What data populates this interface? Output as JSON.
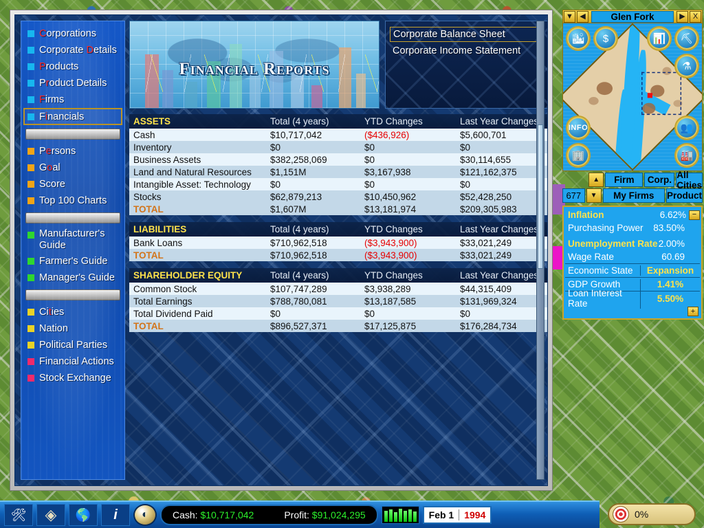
{
  "sidebar": {
    "items": [
      {
        "label": "Corporations",
        "hotkey": "C",
        "color": "#17b6ef",
        "selected": false
      },
      {
        "label": "Corporate Details",
        "hotkey": "D",
        "color": "#17b6ef",
        "selected": false
      },
      {
        "label": "Products",
        "hotkey": "P",
        "color": "#17b6ef",
        "selected": false
      },
      {
        "label": "Product Details",
        "hotkey": "r",
        "color": "#17b6ef",
        "selected": false
      },
      {
        "label": "Firms",
        "hotkey": "F",
        "color": "#17b6ef",
        "selected": false
      },
      {
        "label": "Financials",
        "hotkey": "i",
        "color": "#17b6ef",
        "selected": true
      },
      {
        "separator": true
      },
      {
        "label": "Persons",
        "hotkey": "e",
        "color": "#f0a417",
        "selected": false
      },
      {
        "label": "Goal",
        "hotkey": "o",
        "color": "#f0a417",
        "selected": false
      },
      {
        "label": "Score",
        "hotkey": "",
        "color": "#f0a417",
        "selected": false
      },
      {
        "label": "Top 100 Charts",
        "hotkey": "",
        "color": "#f0a417",
        "selected": false
      },
      {
        "separator": true
      },
      {
        "label": "Manufacturer's Guide",
        "hotkey": "",
        "color": "#2fd62f",
        "selected": false,
        "two_line": true
      },
      {
        "label": "Farmer's Guide",
        "hotkey": "",
        "color": "#2fd62f",
        "selected": false
      },
      {
        "label": "Manager's Guide",
        "hotkey": "",
        "color": "#2fd62f",
        "selected": false
      },
      {
        "separator": true
      },
      {
        "label": "Cities",
        "hotkey": "t",
        "color": "#e8d227",
        "selected": false
      },
      {
        "label": "Nation",
        "hotkey": "",
        "color": "#e8d227",
        "selected": false
      },
      {
        "label": "Political Parties",
        "hotkey": "",
        "color": "#e8d227",
        "selected": false
      },
      {
        "label": "Financial Actions",
        "hotkey": "",
        "color": "#ef2a6b",
        "selected": false
      },
      {
        "label": "Stock Exchange",
        "hotkey": "",
        "color": "#ef2a6b",
        "selected": false
      }
    ]
  },
  "banner": {
    "title": "Financial Reports"
  },
  "report_selector": {
    "items": [
      {
        "label": "Corporate Balance Sheet",
        "selected": true
      },
      {
        "label": "Corporate Income Statement",
        "selected": false
      }
    ]
  },
  "chart_data": {
    "type": "table",
    "title": "Corporate Balance Sheet",
    "columns": [
      "",
      "Total (4 years)",
      "YTD Changes",
      "Last Year Changes"
    ],
    "sections": [
      {
        "name": "ASSETS",
        "rows": [
          {
            "label": "Cash",
            "total": "$10,717,042",
            "ytd": "($436,926)",
            "ytd_negative": true,
            "last_year": "$5,600,701"
          },
          {
            "label": "Inventory",
            "total": "$0",
            "ytd": "$0",
            "ytd_negative": false,
            "last_year": "$0"
          },
          {
            "label": "Business Assets",
            "total": "$382,258,069",
            "ytd": "$0",
            "ytd_negative": false,
            "last_year": "$30,114,655"
          },
          {
            "label": "Land and Natural Resources",
            "total": "$1,151M",
            "ytd": "$3,167,938",
            "ytd_negative": false,
            "last_year": "$121,162,375"
          },
          {
            "label": "Intangible Asset: Technology",
            "total": "$0",
            "ytd": "$0",
            "ytd_negative": false,
            "last_year": "$0"
          },
          {
            "label": "Stocks",
            "total": "$62,879,213",
            "ytd": "$10,450,962",
            "ytd_negative": false,
            "last_year": "$52,428,250"
          }
        ],
        "total": {
          "label": "TOTAL",
          "total": "$1,607M",
          "ytd": "$13,181,974",
          "ytd_negative": false,
          "last_year": "$209,305,983"
        }
      },
      {
        "name": "LIABILITIES",
        "rows": [
          {
            "label": "Bank Loans",
            "total": "$710,962,518",
            "ytd": "($3,943,900)",
            "ytd_negative": true,
            "last_year": "$33,021,249"
          }
        ],
        "total": {
          "label": "TOTAL",
          "total": "$710,962,518",
          "ytd": "($3,943,900)",
          "ytd_negative": true,
          "last_year": "$33,021,249"
        }
      },
      {
        "name": "SHAREHOLDER EQUITY",
        "rows": [
          {
            "label": "Common Stock",
            "total": "$107,747,289",
            "ytd": "$3,938,289",
            "ytd_negative": false,
            "last_year": "$44,315,409"
          },
          {
            "label": "Total Earnings",
            "total": "$788,780,081",
            "ytd": "$13,187,585",
            "ytd_negative": false,
            "last_year": "$131,969,324"
          },
          {
            "label": "Total Dividend Paid",
            "total": "$0",
            "ytd": "$0",
            "ytd_negative": false,
            "last_year": "$0"
          }
        ],
        "total": {
          "label": "TOTAL",
          "total": "$896,527,371",
          "ytd": "$17,125,875",
          "ytd_negative": false,
          "last_year": "$176,284,734"
        }
      }
    ]
  },
  "minimap": {
    "city_name": "Glen Fork",
    "nav": {
      "down": "▼",
      "left": "◀",
      "right": "▶",
      "close": "X"
    },
    "icons": [
      {
        "name": "city-overview-icon",
        "glyph": "🏙"
      },
      {
        "name": "money-icon",
        "glyph": "$"
      },
      {
        "name": "stocks-chart-icon",
        "glyph": "📊"
      },
      {
        "name": "mining-pickaxe-icon",
        "glyph": "⛏"
      },
      {
        "name": "research-icon",
        "glyph": "⚗"
      },
      {
        "name": "info-icon",
        "glyph": "INFO"
      },
      {
        "name": "buildings-icon",
        "glyph": "🏢"
      },
      {
        "name": "people-icon",
        "glyph": "👥"
      },
      {
        "name": "factory-icon",
        "glyph": "🏭"
      }
    ]
  },
  "filter_buttons": {
    "count": "677",
    "up": "▲",
    "down": "▼",
    "row1": [
      "Firm",
      "Corp.",
      "All Cities"
    ],
    "row2": [
      "My Firms",
      "Product"
    ]
  },
  "economy": {
    "rows": [
      {
        "label": "Inflation",
        "value": "6.62%",
        "style": "yellow",
        "has_minus": true
      },
      {
        "label": "Purchasing Power",
        "value": "83.50%",
        "style": "white",
        "has_minus": false
      },
      {
        "label": "Unemployment Rate",
        "value": "2.00%",
        "style": "yellow",
        "has_minus": false
      },
      {
        "label": "Wage Rate",
        "value": "60.69",
        "style": "white",
        "has_minus": false
      }
    ],
    "table_rows": [
      {
        "label": "Economic State",
        "value": "Expansion"
      },
      {
        "label": "GDP Growth",
        "value": "1.41%"
      },
      {
        "label": "Loan Interest Rate",
        "value": "5.50%"
      }
    ],
    "expand_button": "+"
  },
  "statusbar": {
    "tools": [
      {
        "name": "build-tools-icon",
        "glyph": "🛠"
      },
      {
        "name": "minimap-icon",
        "glyph": "◈"
      },
      {
        "name": "world-map-icon",
        "glyph": "🌎"
      },
      {
        "name": "info-icon",
        "glyph": "i"
      },
      {
        "name": "time-speed-icon",
        "glyph": "◐"
      }
    ],
    "cash_label": "Cash:",
    "cash_value": "$10,717,042",
    "profit_label": "Profit:",
    "profit_value": "$91,024,295",
    "date_month": "Feb 1",
    "date_year": "1994",
    "goal_percent": "0%"
  }
}
